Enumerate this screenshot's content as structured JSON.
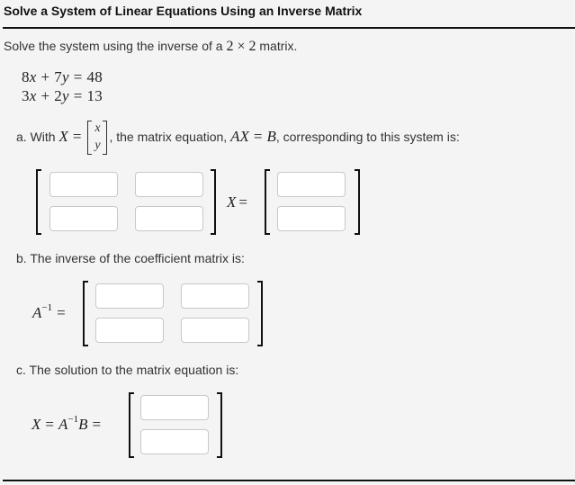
{
  "header": {
    "title": "Solve a System of Linear Equations Using an Inverse Matrix"
  },
  "intro": {
    "prefix": "Solve the system using the inverse of a ",
    "dims": "2 × 2",
    "suffix": " matrix."
  },
  "system": {
    "equations": [
      {
        "a": "8",
        "b": "7",
        "rhs": "48"
      },
      {
        "a": "3",
        "b": "2",
        "rhs": "13"
      }
    ],
    "var1": "x",
    "var2": "y",
    "plus": "+",
    "eq": "="
  },
  "part_a": {
    "prefix": "a. With ",
    "X": "X",
    "eq": "=",
    "vec": [
      "x",
      "y"
    ],
    "middle": ", the matrix equation, ",
    "AX": "AX",
    "B": "B",
    "suffix": ", corresponding to this system is:",
    "matrix_label": "X",
    "inputs": {
      "A11": "",
      "A12": "",
      "A21": "",
      "A22": "",
      "B1": "",
      "B2": ""
    }
  },
  "part_b": {
    "label": "b. The inverse of the coefficient matrix is:",
    "lhs_A": "A",
    "lhs_sup": "−1",
    "eq": "=",
    "inputs": {
      "I11": "",
      "I12": "",
      "I21": "",
      "I22": ""
    }
  },
  "part_c": {
    "label": "c. The solution to the matrix equation is:",
    "X": "X",
    "A": "A",
    "sup": "−1",
    "B": "B",
    "eq": "=",
    "inputs": {
      "X1": "",
      "X2": ""
    }
  }
}
